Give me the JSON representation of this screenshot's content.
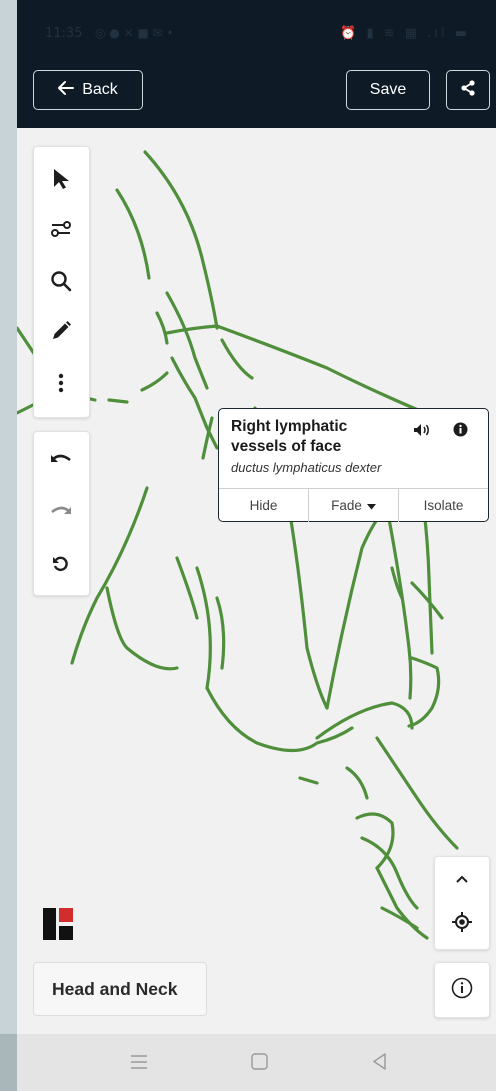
{
  "status_bar": {
    "time": "11:35",
    "left_icons": "◎ ● ✕ ■ ✉ •",
    "right_icons": "⏰ ▮ ≋ ▦ .ıl ▬"
  },
  "header": {
    "back_label": "Back",
    "save_label": "Save"
  },
  "toolbar": {
    "tools": [
      "pointer-icon",
      "toggle-icon",
      "search-icon",
      "pencil-icon",
      "more-icon"
    ],
    "history": [
      "undo-icon",
      "redo-icon",
      "reset-icon"
    ]
  },
  "popup": {
    "title": "Right lymphatic vessels of face",
    "subtitle": "ductus lymphaticus dexter",
    "hide_label": "Hide",
    "fade_label": "Fade",
    "isolate_label": "Isolate"
  },
  "region": {
    "label": "Head and Neck"
  },
  "colors": {
    "header_bg": "#0e1a26",
    "vessel": "#4f8f3b",
    "popup_border": "#1d2731"
  }
}
